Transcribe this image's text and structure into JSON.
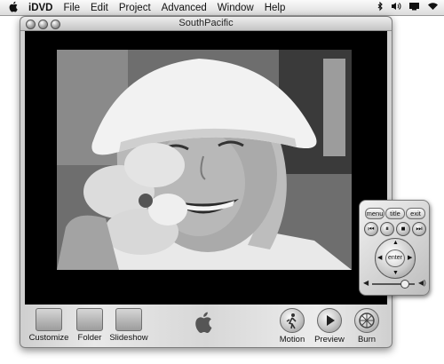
{
  "menubar": {
    "apple": "",
    "app": "iDVD",
    "items": [
      "File",
      "Edit",
      "Project",
      "Advanced",
      "Window",
      "Help"
    ],
    "status_icons": [
      "bluetooth-icon",
      "volume-icon",
      "display-icon",
      "wifi-icon"
    ]
  },
  "window": {
    "title": "SouthPacific"
  },
  "toolbar": {
    "left_buttons": [
      {
        "label": "Customize",
        "icon": "customize-icon"
      },
      {
        "label": "Folder",
        "icon": "folder-icon"
      },
      {
        "label": "Slideshow",
        "icon": "slideshow-icon"
      }
    ],
    "right_buttons": [
      {
        "label": "Motion",
        "icon": "motion-icon"
      },
      {
        "label": "Preview",
        "icon": "play-icon"
      },
      {
        "label": "Burn",
        "icon": "burn-icon"
      }
    ]
  },
  "remote": {
    "menu": "menu",
    "title": "title",
    "exit": "exit",
    "enter": "enter",
    "volume_level": 0.75
  }
}
